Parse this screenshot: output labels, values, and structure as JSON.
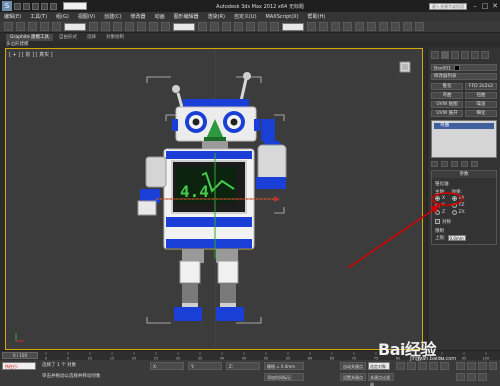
{
  "window": {
    "app_logo": "S",
    "title": "Autodesk 3ds Max 2012 x64    无标题",
    "help_search": "键入关键字或短语",
    "minimize": "–",
    "maximize": "□",
    "close": "✕"
  },
  "menu": [
    "编辑(E)",
    "工具(T)",
    "组(G)",
    "视图(V)",
    "创建(C)",
    "修改器",
    "动画",
    "图形编辑器",
    "渲染(R)",
    "自定义(U)",
    "MAXScript(X)",
    "帮助(H)"
  ],
  "ribbon": {
    "tabs": [
      "Graphite 建模工具",
      "自由形式",
      "选择",
      "对象绘制"
    ],
    "active_tab": 0,
    "viewport_label": "多边形建模"
  },
  "viewport": {
    "label": "[ + ] [ 前 ] [ 真实 ]",
    "screen_text": "4.4"
  },
  "command_panel": {
    "object_name": "Box001",
    "modifier_list": "修改器列表",
    "buttons": [
      "锥化",
      "FFD 2x2x2",
      "弯曲",
      "扭曲",
      "UVW 贴图",
      "噪波",
      "UVW 展开",
      "细化"
    ],
    "stack_item": "弯曲",
    "rollout_title": "参数",
    "section_taper": "锥化轴",
    "main_axis_label": "主轴:",
    "effect_label": "效果:",
    "axes": [
      "X",
      "Y",
      "Z"
    ],
    "effect_axes": [
      "XY",
      "YZ",
      "ZX"
    ],
    "symmetry_label": "对称",
    "limit_label": "限制",
    "upper_label": "上限:",
    "upper_value": "0.0mm"
  },
  "timeline": {
    "slider": "0 / 100",
    "ticks": [
      "0",
      "5",
      "10",
      "15",
      "20",
      "25",
      "30",
      "35",
      "40",
      "45",
      "50",
      "55",
      "60",
      "65",
      "70",
      "75",
      "80",
      "85",
      "90",
      "95",
      "100"
    ]
  },
  "status": {
    "maxscript": "所在行：",
    "line1": "选择了 1 个 对象",
    "line2": "单击并拖动以选择并移动对象",
    "x": "X: ",
    "y": "Y: ",
    "z": "Z: ",
    "grid": "栅格 = 0.0mm",
    "autokey": "自动关键点",
    "setkey": "设置关键点",
    "selected": "选定对象",
    "keyfilter": "关键点过滤器",
    "add_time_tag": "添加时间标记"
  },
  "watermark": {
    "text": "Bai经验",
    "sub": "jingyan.baidu.com"
  },
  "colors": {
    "annotation": "#d20000",
    "robot_blue": "#1a3fd6",
    "selection_yellow": "#d7a900",
    "screen_green": "#47c94a"
  }
}
